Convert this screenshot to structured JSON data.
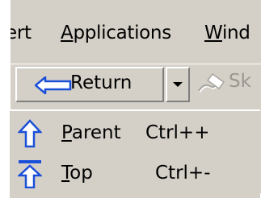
{
  "menubar": {
    "items": [
      {
        "pre": "",
        "acc": "",
        "post": "ert"
      },
      {
        "pre": "",
        "acc": "A",
        "post": "pplications"
      },
      {
        "pre": "",
        "acc": "W",
        "post": "ind"
      }
    ]
  },
  "toolbar": {
    "return_label": "Return",
    "sketch_label": "Sk",
    "icons": [
      "left-arrow-icon",
      "dropdown-arrow-icon",
      "sketch-icon"
    ]
  },
  "dropdown": {
    "items": [
      {
        "acc": "P",
        "rest": "arent",
        "shortcut": "Ctrl++",
        "icon": "up-arrow-icon"
      },
      {
        "acc": "T",
        "rest": "op",
        "shortcut": "Ctrl+-",
        "icon": "top-arrow-icon"
      }
    ]
  },
  "colors": {
    "face": "#d4d0c8",
    "icon_blue": "#1a4fd8",
    "disabled_text": "#9a9790"
  }
}
